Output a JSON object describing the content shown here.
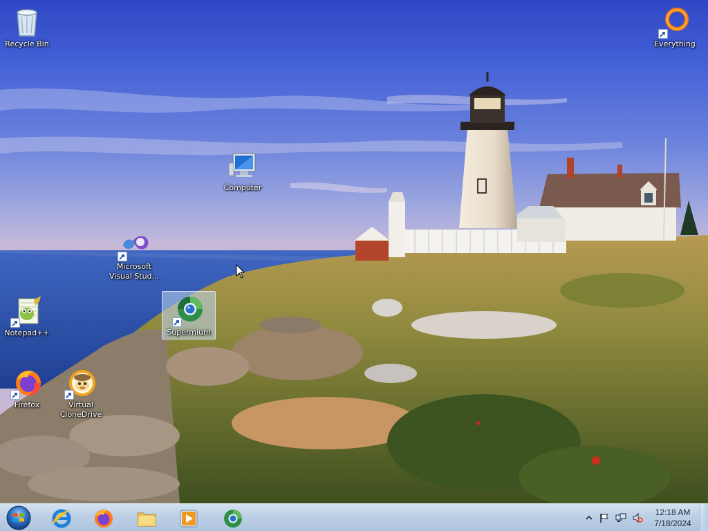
{
  "desktop": {
    "icons": [
      {
        "label": "Recycle Bin",
        "icon": "recycle-bin-icon",
        "shortcut": false,
        "selected": false
      },
      {
        "label": "Everything",
        "icon": "everything-icon",
        "shortcut": true,
        "selected": false
      },
      {
        "label": "Computer",
        "icon": "computer-icon",
        "shortcut": false,
        "selected": false
      },
      {
        "label": "Microsoft Visual Stud...",
        "icon": "visual-studio-icon",
        "shortcut": true,
        "selected": false
      },
      {
        "label": "Notepad++",
        "icon": "notepad-plus-plus-icon",
        "shortcut": true,
        "selected": false
      },
      {
        "label": "Supermium",
        "icon": "supermium-icon",
        "shortcut": true,
        "selected": true
      },
      {
        "label": "Firefox",
        "icon": "firefox-icon",
        "shortcut": true,
        "selected": false
      },
      {
        "label": "Virtual CloneDrive",
        "icon": "virtual-clonedrive-icon",
        "shortcut": true,
        "selected": false
      }
    ],
    "wallpaper": "lighthouse-coast"
  },
  "taskbar": {
    "start_icon": "windows-start-orb-icon",
    "pinned": [
      {
        "name": "Internet Explorer",
        "icon": "internet-explorer-icon"
      },
      {
        "name": "Firefox",
        "icon": "firefox-icon"
      },
      {
        "name": "Windows Explorer",
        "icon": "folder-icon"
      },
      {
        "name": "Windows Media Player",
        "icon": "media-player-icon"
      },
      {
        "name": "Supermium",
        "icon": "supermium-icon"
      }
    ],
    "tray": {
      "icons": [
        "show-hidden-icons-chevron",
        "action-center-flag-icon",
        "network-icon",
        "volume-muted-icon"
      ],
      "time": "12:18 AM",
      "date": "7/18/2024"
    }
  },
  "colors": {
    "sky_top": "#2f46c4",
    "sea": "#2f55b0",
    "taskbar": "#b9cde4",
    "selection": "#bed7f0"
  }
}
